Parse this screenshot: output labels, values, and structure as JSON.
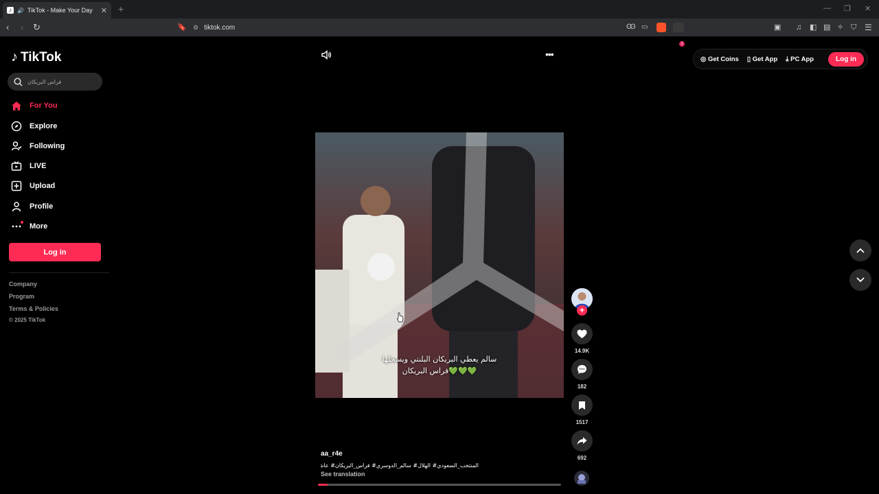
{
  "browser": {
    "tab_title": "TikTok - Make Your Day",
    "url": "tiktok.com",
    "shields_count": "1"
  },
  "brand": {
    "logo_text": "TikTok"
  },
  "search": {
    "query": "فراس البريكان"
  },
  "nav": {
    "items": [
      {
        "label": "For You",
        "icon": "home-icon",
        "active": true
      },
      {
        "label": "Explore",
        "icon": "compass-icon"
      },
      {
        "label": "Following",
        "icon": "following-icon"
      },
      {
        "label": "LIVE",
        "icon": "live-tv-icon"
      },
      {
        "label": "Upload",
        "icon": "plus-square-icon"
      },
      {
        "label": "Profile",
        "icon": "person-icon"
      },
      {
        "label": "More",
        "icon": "more-dots-icon"
      }
    ]
  },
  "sidebar": {
    "login_label": "Log in",
    "footer": [
      "Company",
      "Program",
      "Terms & Policies",
      "© 2025 TikTok"
    ]
  },
  "topbar": {
    "get_coins": "Get Coins",
    "get_app": "Get App",
    "pc_app": "PC App",
    "login": "Log in"
  },
  "video": {
    "caption_line1": "سالم يعطي البريكان البلنتي ويسجلها",
    "caption_line2": "فراس البريكان💚💚💚",
    "author": "aa_r4e",
    "description": "المنتخب_السعودي# الهلال# سالم_الدوسري# فراس_البريكان# عاشوور",
    "see_translation": "See translation",
    "progress": 0.04
  },
  "actions": {
    "likes": "14.9K",
    "comments": "182",
    "saves": "1517",
    "shares": "692"
  },
  "colors": {
    "accent": "#fe2c55",
    "background": "#000000"
  }
}
